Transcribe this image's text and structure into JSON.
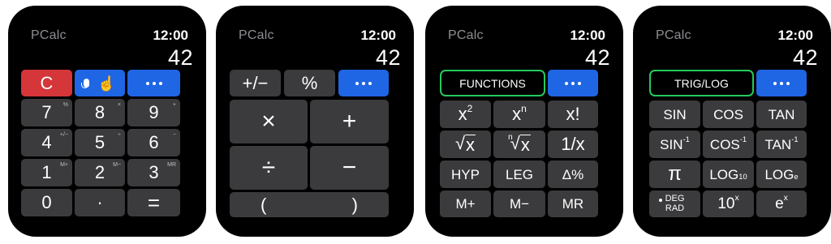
{
  "screens": [
    {
      "app": "PCalc",
      "time": "12:00",
      "display": "42",
      "keys": {
        "c": "C",
        "more": "•••",
        "n7": "7",
        "n7s": "%",
        "n8": "8",
        "n8s": "×",
        "n9": "9",
        "n9s": "+",
        "n4": "4",
        "n4s": "+/−",
        "n5": "5",
        "n5s": "÷",
        "n6": "6",
        "n6s": "−",
        "n1": "1",
        "n1s": "M+",
        "n2": "2",
        "n2s": "M−",
        "n3": "3",
        "n3s": "MR",
        "n0": "0",
        "dot": "·",
        "eq": "="
      }
    },
    {
      "app": "PCalc",
      "time": "12:00",
      "display": "42",
      "keys": {
        "neg": "+/−",
        "pct": "%",
        "more": "•••",
        "mul": "×",
        "add": "+",
        "div": "÷",
        "sub": "−",
        "lp": "(",
        "rp": ")"
      }
    },
    {
      "app": "PCalc",
      "time": "12:00",
      "display": "42",
      "menu": "FUNCTIONS",
      "keys": {
        "more": "•••",
        "x2_base": "x",
        "x2_exp": "2",
        "xn_base": "x",
        "xn_exp": "n",
        "fact": "x!",
        "sqrt_sym": "√",
        "sqrt_arg": "x",
        "nroot_idx": "n",
        "nroot_sym": "√",
        "nroot_arg": "x",
        "inv": "1/x",
        "hyp": "HYP",
        "leg": "LEG",
        "dpct": "Δ%",
        "mplus": "M+",
        "mminus": "M−",
        "mr": "MR"
      }
    },
    {
      "app": "PCalc",
      "time": "12:00",
      "display": "42",
      "menu": "TRIG/LOG",
      "keys": {
        "more": "•••",
        "sin": "SIN",
        "cos": "COS",
        "tan": "TAN",
        "asin": "SIN",
        "acos": "COS",
        "atan": "TAN",
        "inv_exp": "-1",
        "pi": "π",
        "log": "LOG",
        "log_base": "10",
        "ln": "LOG",
        "ln_base": "e",
        "deg": "DEG",
        "rad": "RAD",
        "tenx_base": "10",
        "tenx_exp": "x",
        "ex_base": "e",
        "ex_exp": "x"
      }
    }
  ]
}
